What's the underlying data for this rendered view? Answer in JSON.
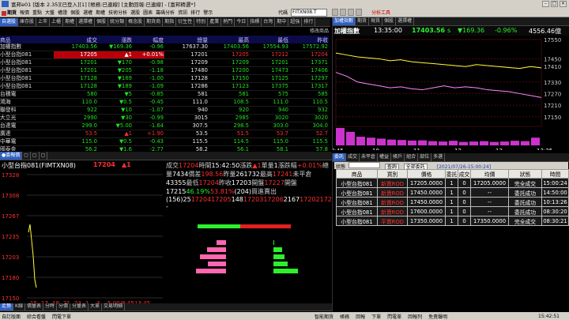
{
  "titlebar": {
    "title": "富邦e01 [版本 2.35][已登入][1] [帳務:已連線] [主動回報:已連線] - [富邦精選*]"
  },
  "menubar": {
    "items": [
      "期貨",
      "報價",
      "重點",
      "大盤",
      "權證",
      "個股",
      "選權",
      "期權",
      "技術分析",
      "選股",
      "圖表",
      "籌碼分析",
      "資訊",
      "排行",
      "警示"
    ],
    "combo_label": "代碼",
    "combo_value": "FITXN08.T",
    "right_label": "分析工具"
  },
  "left_tabs": [
    "自選股",
    "庫存股",
    "上市",
    "上櫃",
    "期權",
    "選擇權",
    "個股",
    "統分類",
    "概念股",
    "期貨商",
    "期指",
    "衍生性",
    "特別",
    "產業",
    "熱門",
    "今日",
    "指標",
    "台灣",
    "期中",
    "超強",
    "排行"
  ],
  "left_action": "修改商品",
  "quote": {
    "headers": [
      "商品",
      "成交",
      "漲跌",
      "幅度",
      "總量",
      "最高",
      "最低",
      "昨收"
    ],
    "rows": [
      [
        "加權指數",
        "17403.56",
        "▼169.36",
        "-0.96",
        "17637.30",
        "17403.56",
        "17554.93",
        "17572.92"
      ],
      [
        "小型台指081",
        "17205",
        "▲1",
        "+0.01%",
        "17201",
        "17205",
        "17212",
        "17204"
      ],
      [
        "小型台指081",
        "17201",
        "▼170",
        "-0.98",
        "17209",
        "17209",
        "17201",
        "17371"
      ],
      [
        "小型台指081",
        "17201",
        "▼205",
        "-1.18",
        "17480",
        "17200",
        "17473",
        "17406"
      ],
      [
        "小型台指081",
        "17128",
        "▼169",
        "-1.00",
        "17128",
        "17150",
        "17125",
        "17297"
      ],
      [
        "小型台指081",
        "17128",
        "▼189",
        "-1.09",
        "17286",
        "17123",
        "17375",
        "17317"
      ],
      [
        "台積電",
        "580",
        "▼5",
        "-0.85",
        "581",
        "581",
        "575",
        "585"
      ],
      [
        "鴻海",
        "110.0",
        "▼0.5",
        "-0.45",
        "111.0",
        "108.5",
        "111.0",
        "110.5"
      ],
      [
        "聯發科",
        "922",
        "▼10",
        "-1.07",
        "940",
        "920",
        "940",
        "932"
      ],
      [
        "大立光",
        "2990",
        "▼30",
        "-0.99",
        "3015",
        "2985",
        "3020",
        "3020"
      ],
      [
        "台達電",
        "299.0",
        "▼5.00",
        "-1.64",
        "307.5",
        "298.5",
        "303.0",
        "304.0"
      ],
      [
        "廣達",
        "53.5",
        "▲1",
        "+1.90",
        "53.5",
        "51.5",
        "53.7",
        "52.7"
      ],
      [
        "中華電",
        "115.0",
        "▼0.5",
        "-0.43",
        "115.5",
        "114.5",
        "115.0",
        "115.5"
      ],
      [
        "國泰金",
        "56.2",
        "▼1.6",
        "-2.77",
        "58.2",
        "56.1",
        "58.1",
        "57.8"
      ],
      [
        "富邦金",
        "78.5",
        "▼3.50",
        "-4.27",
        "82.7",
        "78.5",
        "82.2",
        "82.0"
      ],
      [
        "台化",
        "97.8",
        "▼2.70",
        "-2.69",
        "100.5",
        "97.1",
        "100.5",
        "100.5"
      ],
      [
        "台塑",
        "99.4",
        "▼0.6",
        "-0.60",
        "100.5",
        "99.1",
        "100.5",
        "100.0"
      ],
      [
        "南亞",
        "86.2",
        "▼1.80",
        "-2.05",
        "86.7",
        "86.0",
        "86.7",
        "88.0"
      ]
    ]
  },
  "right_tabs": [
    "加權指數",
    "期貨",
    "現貨",
    "個股",
    "選擇權"
  ],
  "chart_head": {
    "name": "加權指數",
    "time": "13:35:00",
    "price": "17403.56",
    "unit": "s",
    "change": "▼169.36",
    "pct": "-0.96%",
    "volume": "4556.46億"
  },
  "chart_data": {
    "type": "line",
    "x": [
      "8:45",
      "9:00",
      "9:15",
      "9:30",
      "9:45",
      "10:00",
      "10:15",
      "10:30",
      "10:45",
      "11:00",
      "11:15",
      "11:30",
      "11:45",
      "12:00",
      "12:15",
      "12:30",
      "12:45",
      "13:00",
      "13:15",
      "13:35"
    ],
    "series": [
      {
        "name": "指數",
        "color": "#ffff3a",
        "values": [
          17480,
          17470,
          17460,
          17455,
          17450,
          17440,
          17445,
          17435,
          17430,
          17425,
          17420,
          17415,
          17410,
          17420,
          17415,
          17410,
          17405,
          17400,
          17410,
          17403
        ]
      },
      {
        "name": "均價",
        "color": "#ff88ff",
        "values": [
          17380,
          17360,
          17330,
          17320,
          17310,
          17300,
          17305,
          17295,
          17290,
          17300,
          17310,
          17300,
          17305,
          17300,
          17290,
          17285,
          17280,
          17270,
          17260,
          17250
        ]
      }
    ],
    "ylim": [
      17100,
      17550
    ],
    "yticks": [
      "17550",
      "17450",
      "17410",
      "17330",
      "17270",
      "17210",
      "17150"
    ],
    "xticks": [
      "8:45",
      "10",
      "11",
      "12",
      "13",
      "13:35"
    ],
    "volume": [
      90,
      70,
      45,
      40,
      35,
      30,
      28,
      25,
      26,
      22,
      20,
      24,
      18,
      20,
      22,
      18,
      20,
      24,
      22,
      40
    ]
  },
  "bottom_tabs": [
    "走勢",
    "K線",
    "價量表",
    "分時",
    "分價",
    "分量表",
    "大單",
    "交易明細"
  ],
  "detail": {
    "name": "小型台指081(FIMTXN08)",
    "price": "17204",
    "change": "▲1",
    "time_label": "時間",
    "time": "15:42:50",
    "rows_left": [
      [
        "成交",
        "17204",
        "時間",
        "15:42:50"
      ],
      [
        "漲跌",
        "▲1",
        "單量",
        "1"
      ],
      [
        "漲跌幅",
        "+0.01%",
        "總量",
        "7434"
      ],
      [
        "價差",
        "198.56",
        "昨量",
        "261732"
      ],
      [
        "最高",
        "17241",
        "未平倉",
        "43355"
      ],
      [
        "最低",
        "17204",
        "昨收",
        "17203"
      ],
      [
        "開盤",
        "17227",
        "開盤",
        "17215"
      ]
    ],
    "inner_pct": "46.19%",
    "outer_pct": "53.81%",
    "bid_label": "買進",
    "ask_label": "賣出",
    "bid_total": "(204)",
    "ask_total": "(156)",
    "book": [
      {
        "bq": "25",
        "bp": "17204",
        "ap": "17205",
        "aq": "1"
      },
      {
        "bq": "48",
        "bp": "17203",
        "ap": "17206",
        "aq": "21"
      },
      {
        "bq": "67",
        "bp": "17202",
        "ap": "17207",
        "aq": "28"
      },
      {
        "bq": "47",
        "bp": "17201",
        "ap": "17208",
        "aq": "35"
      },
      {
        "bq": "76",
        "bp": "17200",
        "ap": "17209",
        "aq": "61"
      }
    ],
    "footer": {
      "l": "1",
      "m": "17202",
      "r": "--"
    },
    "mini_yticks": [
      "17328",
      "17308",
      "17267",
      "17235",
      "17203",
      "17180",
      "17150"
    ],
    "mini_xticks": [
      "15",
      "17",
      "19",
      "21",
      "23",
      "1",
      "3",
      "5:00/8:45",
      "13:45"
    ]
  },
  "order": {
    "tabs": [
      "委託",
      "成交",
      "未平倉",
      "權益",
      "帳戶",
      "組合",
      "部位",
      "多選"
    ],
    "filter_label": "狀態",
    "query_btn": "查詢",
    "all_label": "全部委託",
    "date": "[2021/07/26-15:00:24]",
    "headers": [
      "商品",
      "買別",
      "價格",
      "委託",
      "成交",
      "均價",
      "狀態",
      "時間"
    ],
    "rows": [
      [
        "小型台指081",
        "新賣ROD",
        "17205.0000",
        "1",
        "0",
        "17205.0000",
        "完全成交",
        "15:00:24"
      ],
      [
        "小型台指081",
        "新賣ROD",
        "17450.0000",
        "1",
        "0",
        "--",
        "委託成功",
        "14:50:00"
      ],
      [
        "小型台指081",
        "新賣ROD",
        "17450.0000",
        "1",
        "0",
        "--",
        "委託成功",
        "10:13:26"
      ],
      [
        "小型台指081",
        "新賣ROD",
        "17600.0000",
        "1",
        "0",
        "--",
        "委託成功",
        "08:30:20"
      ],
      [
        "小型台指081",
        "平賣ROD",
        "17350.0000",
        "1",
        "0",
        "17350.0000",
        "完全成交",
        "08:30:21"
      ]
    ]
  },
  "statusbar": {
    "items": [
      "自訂版面",
      "綜合看盤",
      "閃電下單",
      "智能期貨",
      "帳務",
      "回報",
      "下單",
      "閃電單",
      "回報列",
      "免責聲明"
    ],
    "time": "15:42:51"
  }
}
